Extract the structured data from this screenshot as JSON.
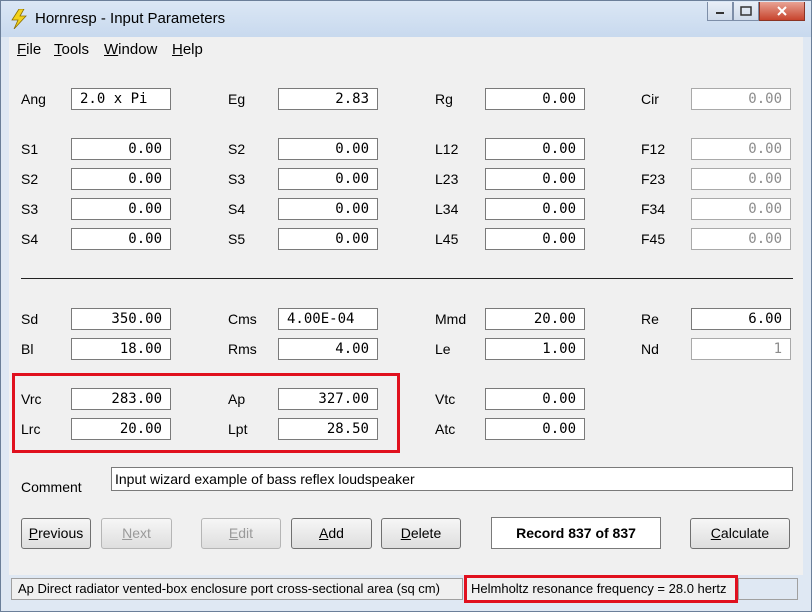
{
  "window": {
    "title": "Hornresp - Input Parameters"
  },
  "menu": [
    "File",
    "Tools",
    "Window",
    "Help"
  ],
  "row_top": [
    {
      "label": "Ang",
      "value": "2.0 x Pi",
      "align": "left"
    },
    {
      "label": "Eg",
      "value": "2.83"
    },
    {
      "label": "Rg",
      "value": "0.00"
    },
    {
      "label": "Cir",
      "value": "0.00",
      "disabled": true
    }
  ],
  "grid_sections": [
    [
      {
        "label": "S1",
        "value": "0.00"
      },
      {
        "label": "S2",
        "value": "0.00"
      },
      {
        "label": "L12",
        "value": "0.00"
      },
      {
        "label": "F12",
        "value": "0.00",
        "disabled": true
      }
    ],
    [
      {
        "label": "S2",
        "value": "0.00"
      },
      {
        "label": "S3",
        "value": "0.00"
      },
      {
        "label": "L23",
        "value": "0.00"
      },
      {
        "label": "F23",
        "value": "0.00",
        "disabled": true
      }
    ],
    [
      {
        "label": "S3",
        "value": "0.00"
      },
      {
        "label": "S4",
        "value": "0.00"
      },
      {
        "label": "L34",
        "value": "0.00"
      },
      {
        "label": "F34",
        "value": "0.00",
        "disabled": true
      }
    ],
    [
      {
        "label": "S4",
        "value": "0.00"
      },
      {
        "label": "S5",
        "value": "0.00"
      },
      {
        "label": "L45",
        "value": "0.00"
      },
      {
        "label": "F45",
        "value": "0.00",
        "disabled": true
      }
    ]
  ],
  "driver_rows": [
    [
      {
        "label": "Sd",
        "value": "350.00"
      },
      {
        "label": "Cms",
        "value": "4.00E-04",
        "align": "left"
      },
      {
        "label": "Mmd",
        "value": "20.00"
      },
      {
        "label": "Re",
        "value": "6.00"
      }
    ],
    [
      {
        "label": "Bl",
        "value": "18.00"
      },
      {
        "label": "Rms",
        "value": "4.00"
      },
      {
        "label": "Le",
        "value": "1.00"
      },
      {
        "label": "Nd",
        "value": "1",
        "disabled": true
      }
    ],
    [
      {
        "label": "Vrc",
        "value": "283.00"
      },
      {
        "label": "Ap",
        "value": "327.00"
      },
      {
        "label": "Vtc",
        "value": "0.00"
      }
    ],
    [
      {
        "label": "Lrc",
        "value": "20.00"
      },
      {
        "label": "Lpt",
        "value": "28.50"
      },
      {
        "label": "Atc",
        "value": "0.00"
      }
    ]
  ],
  "comment": {
    "label": "Comment",
    "value": "Input wizard example of bass reflex loudspeaker"
  },
  "buttons": [
    {
      "name": "previous",
      "label": "Previous",
      "accel": "P",
      "disabled": false
    },
    {
      "name": "next",
      "label": "Next",
      "accel": "N",
      "disabled": true
    },
    {
      "name": "edit",
      "label": "Edit",
      "accel": "E",
      "disabled": true
    },
    {
      "name": "add",
      "label": "Add",
      "accel": "A",
      "disabled": false
    },
    {
      "name": "delete",
      "label": "Delete",
      "accel": "D",
      "disabled": false
    },
    {
      "name": "calculate",
      "label": "Calculate",
      "accel": "C",
      "disabled": false
    }
  ],
  "record": "Record 837 of 837",
  "status": {
    "left": "Ap   Direct radiator vented-box enclosure port cross-sectional area  (sq cm)",
    "right": "Helmholtz resonance frequency = 28.0 hertz"
  },
  "colors": {
    "highlight": "#e0101e",
    "title_bg": "#dbe7f5"
  }
}
